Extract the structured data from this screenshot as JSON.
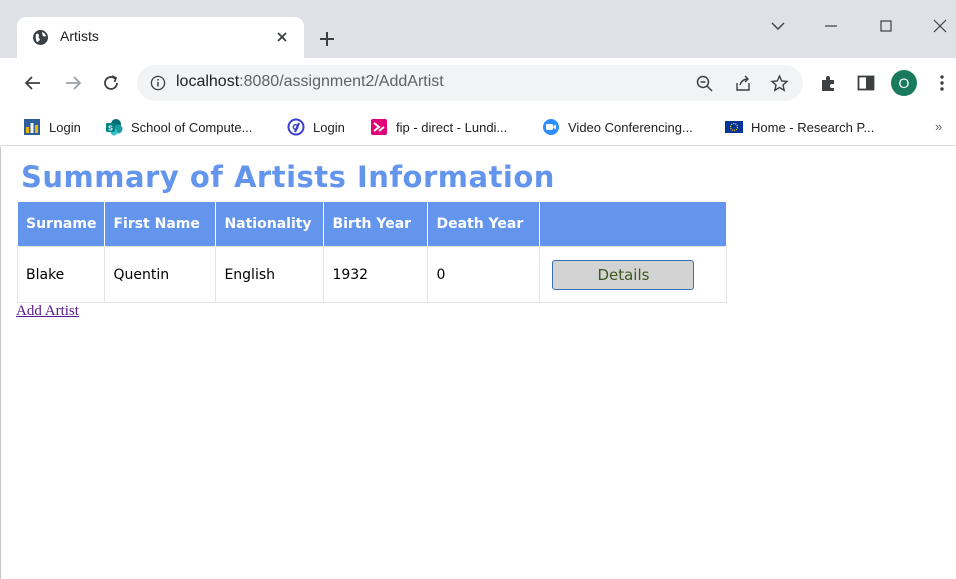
{
  "browser": {
    "tab_title": "Artists",
    "url_host": "localhost",
    "url_path": ":8080/assignment2/AddArtist",
    "profile_initial": "O",
    "bookmarks": [
      {
        "label": "Login",
        "icon": "gmail-grid-icon"
      },
      {
        "label": "School of Compute...",
        "icon": "sharepoint-icon"
      },
      {
        "label": "Login",
        "icon": "circled-at-icon"
      },
      {
        "label": "fip - direct - Lundi...",
        "icon": "fip-icon"
      },
      {
        "label": "Video Conferencing...",
        "icon": "zoom-icon"
      },
      {
        "label": "Home - Research P...",
        "icon": "eu-flag-icon"
      }
    ],
    "more_bookmarks": "»"
  },
  "page": {
    "title": "Summary of Artists Information",
    "table": {
      "headers": [
        "Surname",
        "First Name",
        "Nationality",
        "Birth Year",
        "Death Year",
        ""
      ],
      "rows": [
        {
          "surname": "Blake",
          "first_name": "Quentin",
          "nationality": "English",
          "birth_year": "1932",
          "death_year": "0",
          "action": "Details"
        }
      ]
    },
    "add_link": "Add Artist"
  },
  "colors": {
    "accent": "#6495ed",
    "link_visited": "#551a8b",
    "chrome_bg": "#dee1e6",
    "profile": "#1a7a5c"
  }
}
